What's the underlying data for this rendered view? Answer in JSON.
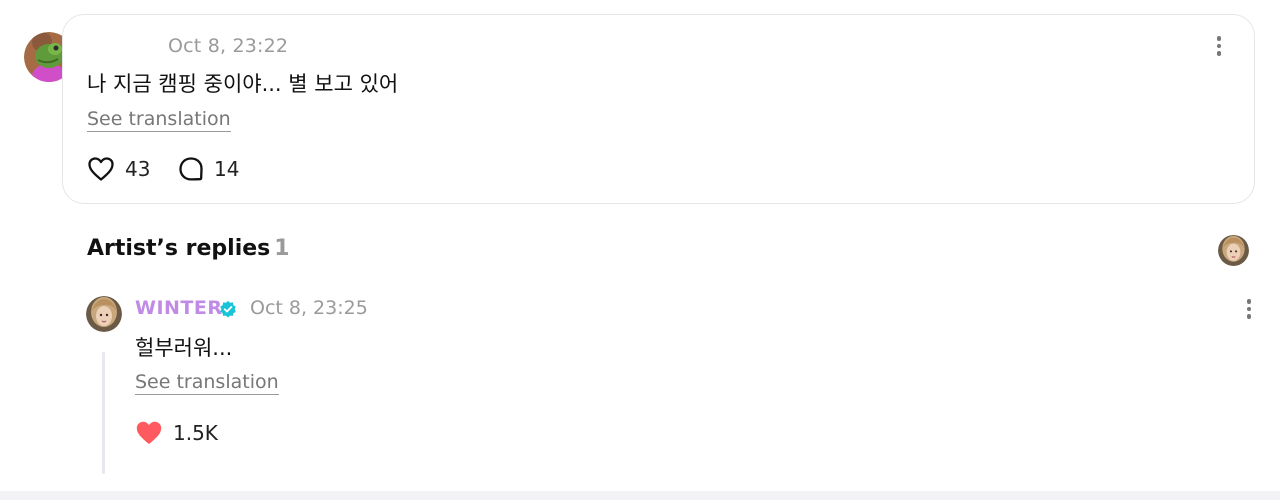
{
  "post": {
    "timestamp": "Oct 8, 23:22",
    "text": "나 지금 캠핑 중이야... 별 보고 있어",
    "see_translation": "See translation",
    "like_count": "43",
    "comment_count": "14"
  },
  "artist_replies": {
    "title": "Artist’s replies",
    "count": "1",
    "reply": {
      "author": "WINTER",
      "timestamp": "Oct 8, 23:25",
      "text": "헐부러워...",
      "see_translation": "See translation",
      "like_count": "1.5K"
    }
  },
  "colors": {
    "artist_name": "#c08be6",
    "verified_badge": "#19c4d8",
    "liked_heart": "#ff5a5f"
  },
  "icons": {
    "user_avatar": "green-frog-character-avatar",
    "artist_avatar": "artist-photo-avatar",
    "like": "heart-outline-icon",
    "comment": "speech-bubble-icon",
    "more": "vertical-ellipsis-icon",
    "verified": "verified-badge-icon",
    "liked": "heart-filled-icon"
  }
}
